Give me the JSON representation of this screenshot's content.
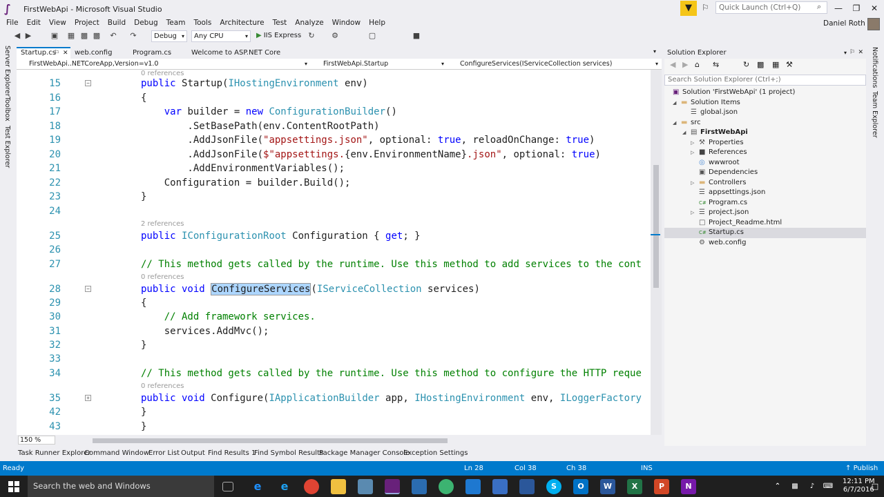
{
  "window": {
    "title": "FirstWebApi - Microsoft Visual Studio",
    "logo": "∫",
    "quick_launch_placeholder": "Quick Launch (Ctrl+Q)",
    "user": "Daniel Roth",
    "controls": {
      "minimize": "—",
      "maximize": "❐",
      "close": "✕"
    }
  },
  "icons": {
    "filter": "▼",
    "pin": "⚐",
    "search": "⌕"
  },
  "menu": [
    "File",
    "Edit",
    "View",
    "Project",
    "Build",
    "Debug",
    "Team",
    "Tools",
    "Architecture",
    "Test",
    "Analyze",
    "Window",
    "Help"
  ],
  "toolbar": {
    "config": "Debug",
    "platform": "Any CPU",
    "run_label": "IIS Express",
    "play_glyph": "▶",
    "caret": "▾"
  },
  "side_tabs": {
    "left": [
      "Server Explorer",
      "Toolbox",
      "Test Explorer"
    ],
    "right": [
      "Notifications",
      "Team Explorer"
    ]
  },
  "doc_tabs": [
    {
      "label": "Startup.cs",
      "pin": "⚐",
      "close": "✕",
      "active": true
    },
    {
      "label": "web.config",
      "active": false
    },
    {
      "label": "Program.cs",
      "active": false
    },
    {
      "label": "Welcome to ASP.NET Core",
      "active": false
    }
  ],
  "nav_bar": {
    "project": "FirstWebApi..NETCoreApp,Version=v1.0",
    "type": "FirstWebApi.Startup",
    "member": "ConfigureServices(IServiceCollection services)"
  },
  "code": {
    "codelens_top": "0 references",
    "lines": [
      {
        "num": "15",
        "fold": "−",
        "parts": [
          [
            "kw",
            "public "
          ],
          [
            "",
            "Startup("
          ],
          [
            "ty",
            "IHostingEnvironment"
          ],
          [
            "",
            " env)"
          ]
        ]
      },
      {
        "num": "16",
        "parts": [
          [
            "",
            "{"
          ]
        ]
      },
      {
        "num": "17",
        "parts": [
          [
            "kw",
            "    var "
          ],
          [
            "",
            "builder = "
          ],
          [
            "kw",
            "new "
          ],
          [
            "ty",
            "ConfigurationBuilder"
          ],
          [
            "",
            "()"
          ]
        ]
      },
      {
        "num": "18",
        "parts": [
          [
            "",
            "        .SetBasePath(env.ContentRootPath)"
          ]
        ]
      },
      {
        "num": "19",
        "parts": [
          [
            "",
            "        .AddJsonFile("
          ],
          [
            "st",
            "\"appsettings.json\""
          ],
          [
            "",
            ", optional: "
          ],
          [
            "kw",
            "true"
          ],
          [
            "",
            ", reloadOnChange: "
          ],
          [
            "kw",
            "true"
          ],
          [
            "",
            ")"
          ]
        ]
      },
      {
        "num": "20",
        "parts": [
          [
            "",
            "        .AddJsonFile("
          ],
          [
            "st",
            "$\"appsettings."
          ],
          [
            "",
            "{env.EnvironmentName}"
          ],
          [
            "st",
            ".json\""
          ],
          [
            "",
            ", optional: "
          ],
          [
            "kw",
            "true"
          ],
          [
            "",
            ")"
          ]
        ]
      },
      {
        "num": "21",
        "parts": [
          [
            "",
            "        .AddEnvironmentVariables();"
          ]
        ]
      },
      {
        "num": "22",
        "parts": [
          [
            "",
            "    Configuration = builder.Build();"
          ]
        ]
      },
      {
        "num": "23",
        "parts": [
          [
            "",
            "}"
          ]
        ]
      },
      {
        "num": "24",
        "parts": []
      },
      {
        "num": "25",
        "lens": "2 references",
        "parts": [
          [
            "kw",
            "public "
          ],
          [
            "ty",
            "IConfigurationRoot"
          ],
          [
            "",
            " Configuration { "
          ],
          [
            "kw",
            "get"
          ],
          [
            "",
            "; }"
          ]
        ]
      },
      {
        "num": "26",
        "parts": []
      },
      {
        "num": "27",
        "parts": [
          [
            "cm",
            "// This method gets called by the runtime. Use this method to add services to the cont"
          ]
        ]
      },
      {
        "num": "28",
        "lens": "0 references",
        "fold": "−",
        "parts": [
          [
            "kw",
            "public void "
          ],
          [
            "sel",
            "ConfigureServices"
          ],
          [
            "",
            "("
          ],
          [
            "ty",
            "IServiceCollection"
          ],
          [
            "",
            " services)"
          ]
        ]
      },
      {
        "num": "29",
        "parts": [
          [
            "",
            "{"
          ]
        ]
      },
      {
        "num": "30",
        "parts": [
          [
            "cm",
            "    // Add framework services."
          ]
        ]
      },
      {
        "num": "31",
        "parts": [
          [
            "",
            "    services.AddMvc();"
          ]
        ]
      },
      {
        "num": "32",
        "parts": [
          [
            "",
            "}"
          ]
        ]
      },
      {
        "num": "33",
        "parts": []
      },
      {
        "num": "34",
        "parts": [
          [
            "cm",
            "// This method gets called by the runtime. Use this method to configure the HTTP reque"
          ]
        ]
      },
      {
        "num": "35",
        "lens": "0 references",
        "fold": "+",
        "parts": [
          [
            "kw",
            "public void "
          ],
          [
            "",
            "Configure("
          ],
          [
            "ty",
            "IApplicationBuilder"
          ],
          [
            "",
            " app, "
          ],
          [
            "ty",
            "IHostingEnvironment"
          ],
          [
            "",
            " env, "
          ],
          [
            "ty",
            "ILoggerFactory"
          ]
        ]
      },
      {
        "num": "42",
        "parts": [
          [
            "",
            "}"
          ]
        ]
      },
      {
        "num": "43",
        "parts": [
          [
            "",
            "}"
          ]
        ]
      }
    ]
  },
  "zoom": "150 %",
  "solution_explorer": {
    "title": "Solution Explorer",
    "search_placeholder": "Search Solution Explorer (Ctrl+;)",
    "items": [
      {
        "label": "Solution 'FirstWebApi' (1 project)",
        "icon": "solution",
        "exp": ""
      },
      {
        "label": "Solution Items",
        "icon": "folder",
        "exp": "◢"
      },
      {
        "label": "global.json",
        "icon": "json",
        "exp": ""
      },
      {
        "label": "src",
        "icon": "folder",
        "exp": "◢"
      },
      {
        "label": "FirstWebApi",
        "icon": "project",
        "exp": "◢",
        "bold": true
      },
      {
        "label": "Properties",
        "icon": "wrench",
        "exp": "▷"
      },
      {
        "label": "References",
        "icon": "refs",
        "exp": "▷"
      },
      {
        "label": "wwwroot",
        "icon": "globe",
        "exp": ""
      },
      {
        "label": "Dependencies",
        "icon": "deps",
        "exp": ""
      },
      {
        "label": "Controllers",
        "icon": "folder",
        "exp": "▷"
      },
      {
        "label": "appsettings.json",
        "icon": "json",
        "exp": ""
      },
      {
        "label": "Program.cs",
        "icon": "cs",
        "exp": ""
      },
      {
        "label": "project.json",
        "icon": "json",
        "exp": "▷"
      },
      {
        "label": "Project_Readme.html",
        "icon": "html",
        "exp": ""
      },
      {
        "label": "Startup.cs",
        "icon": "cs",
        "exp": "",
        "selected": true
      },
      {
        "label": "web.config",
        "icon": "config",
        "exp": ""
      }
    ]
  },
  "bottom_tabs": [
    "Task Runner Explorer",
    "Command Window",
    "Error List",
    "Output",
    "Find Results 1",
    "Find Symbol Results",
    "Package Manager Console",
    "Exception Settings"
  ],
  "status": {
    "ready": "Ready",
    "ln": "Ln 28",
    "col": "Col 38",
    "ch": "Ch 38",
    "ins": "INS",
    "publish": "Publish",
    "publish_icon": "↑"
  },
  "taskbar": {
    "search_placeholder": "Search the web and Windows",
    "time": "12:11 PM",
    "date": "6/7/2016"
  },
  "colors": {
    "accent": "#007acc",
    "keyword": "#0000ff",
    "type": "#2b91af",
    "string": "#a31515",
    "comment": "#008000"
  }
}
